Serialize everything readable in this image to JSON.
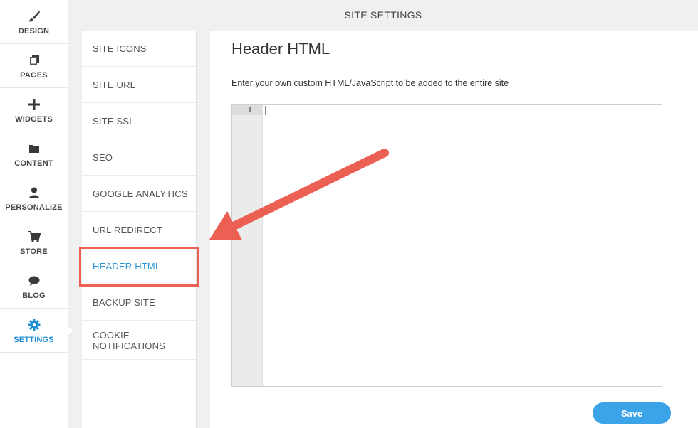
{
  "rail": {
    "items": [
      {
        "label": "DESIGN",
        "icon": "paintbrush-icon"
      },
      {
        "label": "PAGES",
        "icon": "pages-icon"
      },
      {
        "label": "WIDGETS",
        "icon": "plus-icon"
      },
      {
        "label": "CONTENT",
        "icon": "folder-icon"
      },
      {
        "label": "PERSONALIZE",
        "icon": "user-icon"
      },
      {
        "label": "STORE",
        "icon": "cart-icon"
      },
      {
        "label": "BLOG",
        "icon": "chat-bubble-icon"
      },
      {
        "label": "SETTINGS",
        "icon": "gear-icon",
        "active": true
      }
    ]
  },
  "header": {
    "title": "SITE SETTINGS"
  },
  "settings_menu": {
    "items": [
      {
        "label": "SITE ICONS"
      },
      {
        "label": "SITE URL"
      },
      {
        "label": "SITE SSL"
      },
      {
        "label": "SEO"
      },
      {
        "label": "GOOGLE ANALYTICS"
      },
      {
        "label": "URL REDIRECT"
      },
      {
        "label": "HEADER HTML",
        "active": true
      },
      {
        "label": "BACKUP SITE"
      },
      {
        "label": "COOKIE NOTIFICATIONS"
      }
    ]
  },
  "panel": {
    "title": "Header HTML",
    "description": "Enter your own custom HTML/JavaScript to be added to the entire site",
    "editor": {
      "line_number": "1",
      "content": ""
    },
    "save_label": "Save"
  },
  "colors": {
    "accent": "#2a93d5",
    "annotation": "#ec5f53",
    "save_button": "#3ba3e8"
  }
}
